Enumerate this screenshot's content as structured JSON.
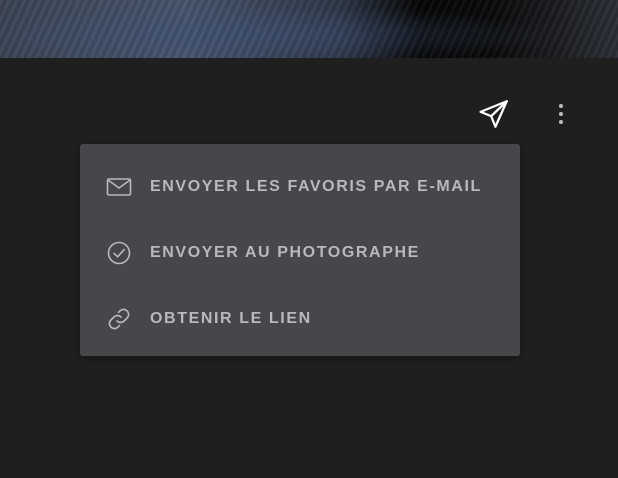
{
  "toolbar": {
    "send_icon": "paper-plane-icon",
    "more_icon": "more-vertical-icon"
  },
  "menu": {
    "items": [
      {
        "icon": "envelope-icon",
        "label": "ENVOYER LES FAVORIS PAR E-MAIL"
      },
      {
        "icon": "check-circle-icon",
        "label": "ENVOYER AU PHOTOGRAPHE"
      },
      {
        "icon": "link-icon",
        "label": "OBTENIR LE LIEN"
      }
    ]
  },
  "colors": {
    "background": "#1f1f1f",
    "menu_background": "#47464a",
    "menu_text": "#b9b9bc",
    "icon_white": "#ffffff"
  }
}
